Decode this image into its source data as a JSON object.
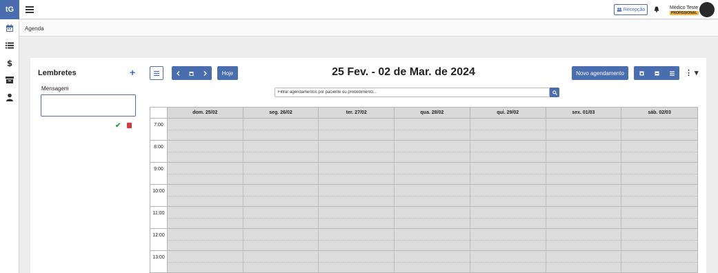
{
  "app": {
    "logo": "tG"
  },
  "sidebar": {
    "items": [
      {
        "icon": "calendar-icon"
      },
      {
        "icon": "list-icon"
      },
      {
        "icon": "dollar-icon"
      },
      {
        "icon": "archive-icon"
      },
      {
        "icon": "user-icon"
      }
    ]
  },
  "topbar": {
    "recepcao_label": "Recepção",
    "user_name": "Médico Teste",
    "user_role": "PROFISSIONAL"
  },
  "breadcrumb": "Agenda",
  "reminders": {
    "title": "Lembretes",
    "add_label": "+",
    "message_label": "Mensagem",
    "message_value": ""
  },
  "toolbar": {
    "hoje_label": "Hoje",
    "week_title": "25 Fev. - 02 de Mar. de 2024",
    "novo_label": "Novo agendamento"
  },
  "filter": {
    "placeholder": "Filtrar agendamentos por paciente ou procedimento..."
  },
  "calendar": {
    "days": [
      "dom. 25/02",
      "seg. 26/02",
      "ter. 27/02",
      "qua. 28/02",
      "qui. 29/02",
      "sex. 01/03",
      "sáb. 02/03"
    ],
    "hours": [
      "7:00",
      "8:00",
      "9:00",
      "10:00",
      "11:00",
      "12:00",
      "13:00"
    ]
  },
  "colors": {
    "accent": "#4a6db0",
    "badge": "#f0b63f",
    "success": "#2e9e3c",
    "danger": "#d23b3b"
  }
}
